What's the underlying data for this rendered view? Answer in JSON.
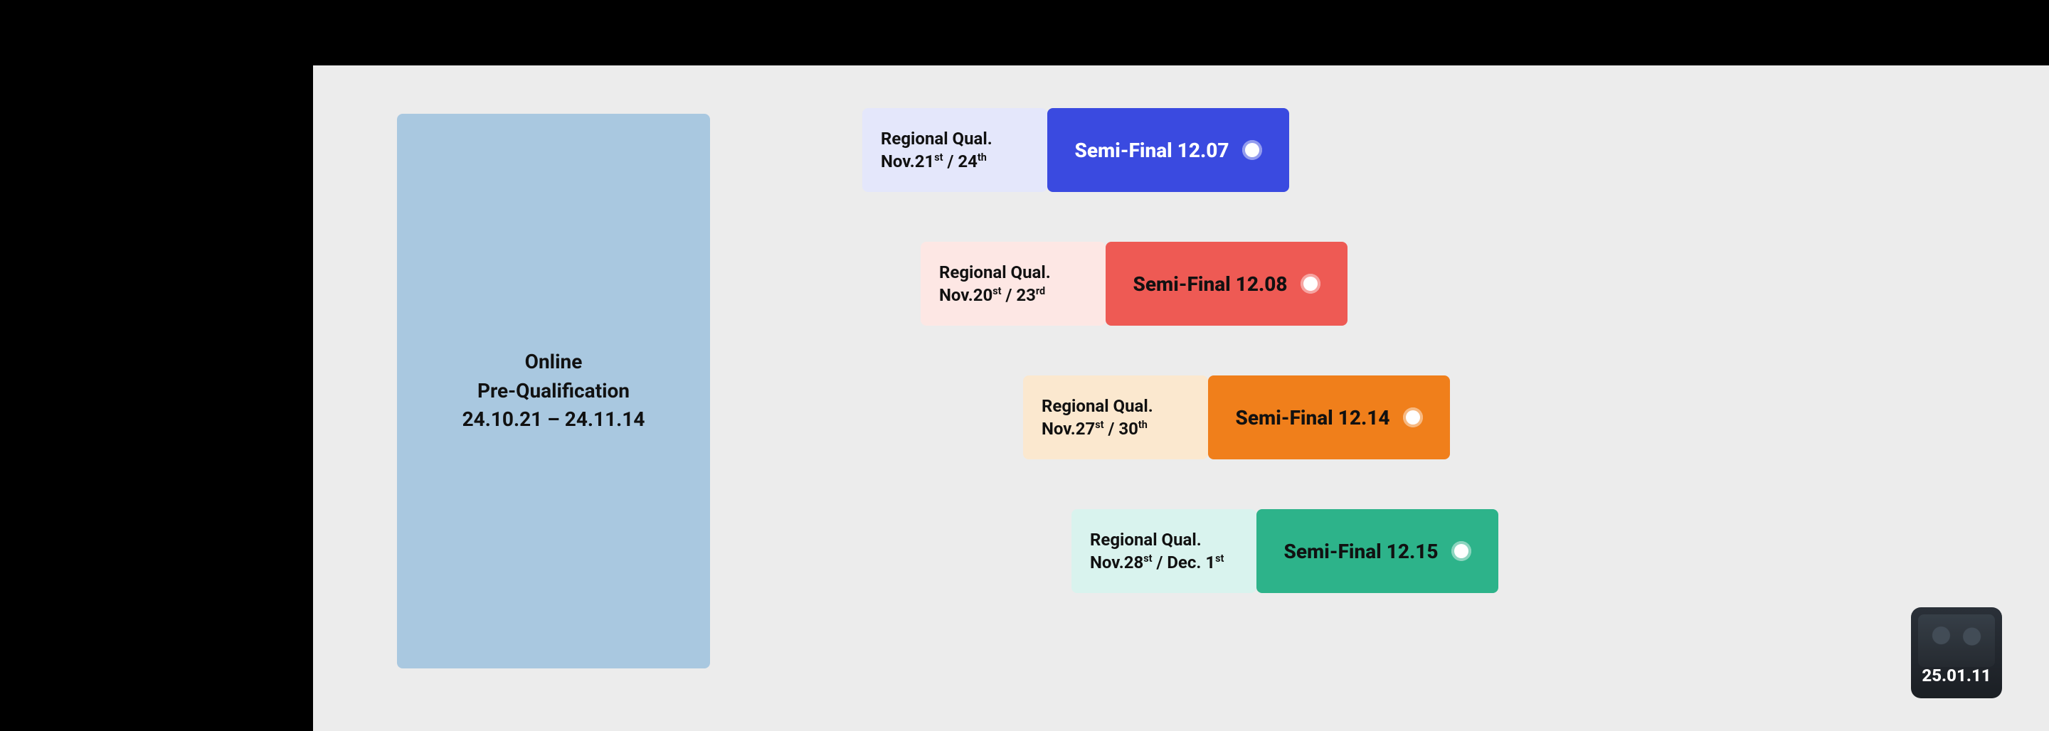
{
  "prequal": {
    "line1": "Online",
    "line2": "Pre-Qualification",
    "line3": "24.10.21 – 24.11.14"
  },
  "rows": [
    {
      "qual_label": "Regional Qual.",
      "qual_date_html": "Nov.21<sup>st</sup> / 24<sup>th</sup>",
      "semi_label": "Semi-Final 12.07"
    },
    {
      "qual_label": "Regional Qual.",
      "qual_date_html": "Nov.20<sup>st</sup> / 23<sup>rd</sup>",
      "semi_label": "Semi-Final 12.08"
    },
    {
      "qual_label": "Regional Qual.",
      "qual_date_html": "Nov.27<sup>st</sup> / 30<sup>th</sup>",
      "semi_label": "Semi-Final 12.14"
    },
    {
      "qual_label": "Regional Qual.",
      "qual_date_html": "Nov.28<sup>st</sup> / Dec. 1<sup>st</sup>",
      "semi_label": "Semi-Final 12.15"
    }
  ],
  "final_label": "25.01.11",
  "colors": {
    "canvas": "#ececec",
    "prequal": "#a9c8e0",
    "rows": [
      "#3a4ae0",
      "#ee5a54",
      "#f07f1b",
      "#2db38a"
    ]
  }
}
